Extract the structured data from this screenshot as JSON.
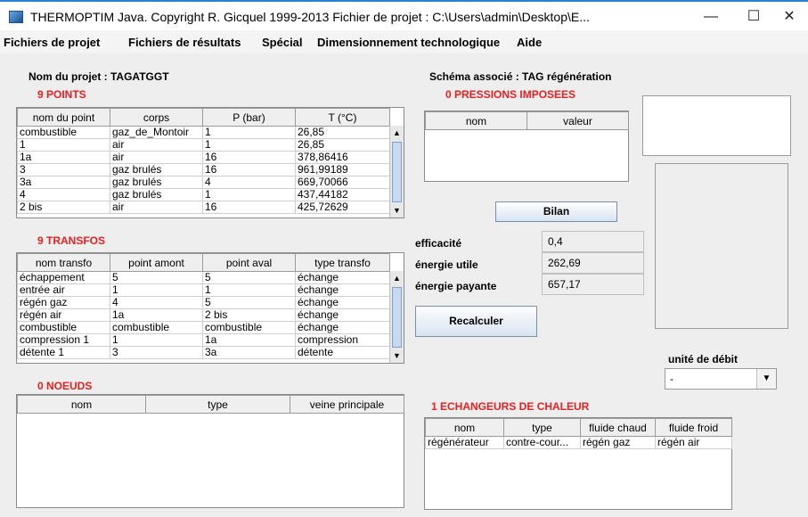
{
  "window": {
    "title": "THERMOPTIM Java.   Copyright R. Gicquel 1999-2013  Fichier de projet : C:\\Users\\admin\\Desktop\\E...",
    "minimize": "—",
    "maximize": "☐",
    "close": "✕"
  },
  "menu": [
    "Fichiers de projet",
    "Fichiers de résultats",
    "Spécial",
    "Dimensionnement technologique",
    "Aide"
  ],
  "project": {
    "name_label": "Nom du projet : TAGATGGT",
    "schema_label": "Schéma associé : TAG régénération"
  },
  "points": {
    "title": "9  POINTS",
    "columns": [
      "nom du point",
      "corps",
      "P (bar)",
      "T (°C)"
    ],
    "rows": [
      [
        "combustible",
        "gaz_de_Montoir",
        "1",
        "26,85"
      ],
      [
        "1",
        "air",
        "1",
        "26,85"
      ],
      [
        "1a",
        "air",
        "16",
        "378,86416"
      ],
      [
        "3",
        "gaz brulés",
        "16",
        "961,99189"
      ],
      [
        "3a",
        "gaz brulés",
        "4",
        "669,70066"
      ],
      [
        "4",
        "gaz brulés",
        "1",
        "437,44182"
      ],
      [
        "2 bis",
        "air",
        "16",
        "425,72629"
      ]
    ]
  },
  "transfos": {
    "title": "9  TRANSFOS",
    "columns": [
      "nom transfo",
      "point amont",
      "point aval",
      "type transfo"
    ],
    "rows": [
      [
        "échappement",
        "5",
        "5",
        "échange"
      ],
      [
        "entrée air",
        "1",
        "1",
        "échange"
      ],
      [
        "régén gaz",
        "4",
        "5",
        "échange"
      ],
      [
        "régén air",
        "1a",
        "2 bis",
        "échange"
      ],
      [
        "combustible",
        "combustible",
        "combustible",
        "échange"
      ],
      [
        "compression 1",
        "1",
        "1a",
        "compression"
      ],
      [
        "détente 1",
        "3",
        "3a",
        "détente"
      ]
    ]
  },
  "noeuds": {
    "title": "0  NOEUDS",
    "columns": [
      "nom",
      "type",
      "veine principale"
    ]
  },
  "pressions": {
    "title": "0  PRESSIONS IMPOSEES",
    "columns": [
      "nom",
      "valeur"
    ]
  },
  "bilan": {
    "button": "Bilan",
    "efficacite_label": "efficacité",
    "efficacite_value": "0,4",
    "energie_utile_label": "énergie utile",
    "energie_utile_value": "262,69",
    "energie_payante_label": "énergie payante",
    "energie_payante_value": "657,17",
    "recalc_button": "Recalculer"
  },
  "debit": {
    "label": "unité de débit",
    "value": "-"
  },
  "echangeurs": {
    "title": "1  ECHANGEURS DE CHALEUR",
    "columns": [
      "nom",
      "type",
      "fluide chaud",
      "fluide froid"
    ],
    "rows": [
      [
        "régénérateur",
        "contre-cour...",
        "régén gaz",
        "régén air"
      ]
    ]
  }
}
